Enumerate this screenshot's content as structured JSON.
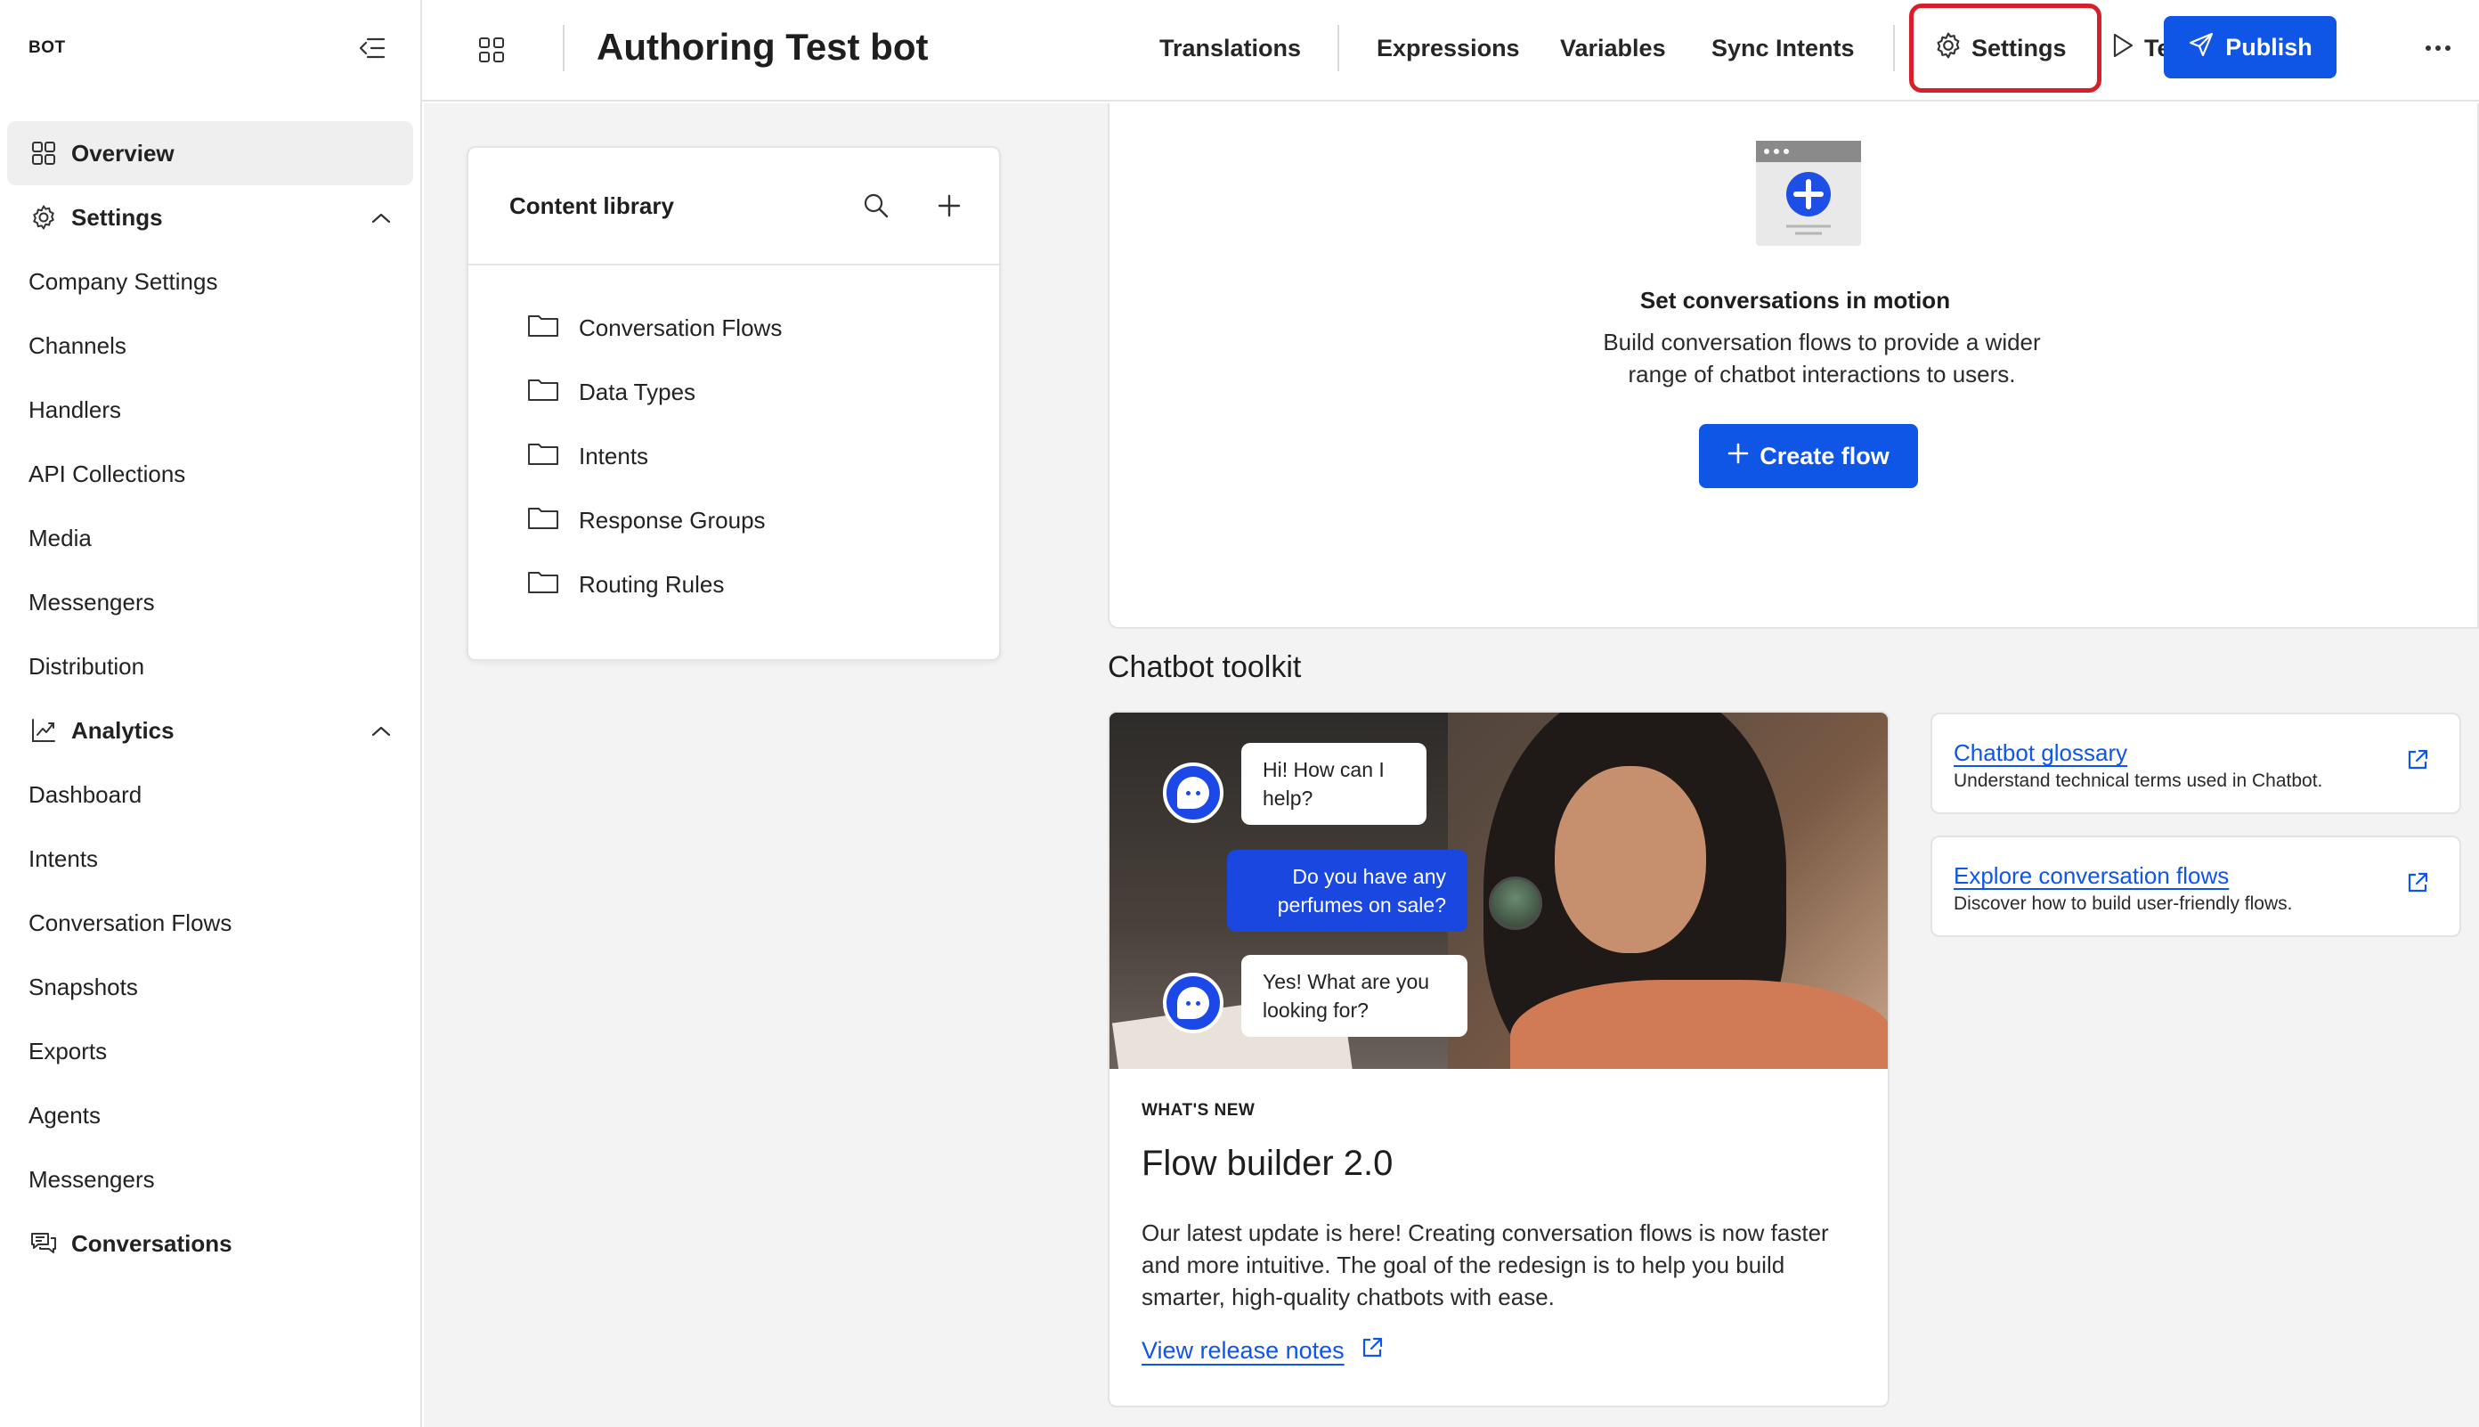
{
  "sidebar": {
    "brand": "BOT",
    "items": [
      {
        "label": "Overview",
        "type": "section",
        "icon": "grid-icon",
        "active": true
      },
      {
        "label": "Settings",
        "type": "section",
        "icon": "gear-icon",
        "expanded": true
      },
      {
        "label": "Company Settings",
        "type": "item"
      },
      {
        "label": "Channels",
        "type": "item"
      },
      {
        "label": "Handlers",
        "type": "item"
      },
      {
        "label": "API Collections",
        "type": "item"
      },
      {
        "label": "Media",
        "type": "item"
      },
      {
        "label": "Messengers",
        "type": "item"
      },
      {
        "label": "Distribution",
        "type": "item"
      },
      {
        "label": "Analytics",
        "type": "section",
        "icon": "analytics-icon",
        "expanded": true
      },
      {
        "label": "Dashboard",
        "type": "item"
      },
      {
        "label": "Intents",
        "type": "item"
      },
      {
        "label": "Conversation Flows",
        "type": "item"
      },
      {
        "label": "Snapshots",
        "type": "item"
      },
      {
        "label": "Exports",
        "type": "item"
      },
      {
        "label": "Agents",
        "type": "item"
      },
      {
        "label": "Messengers",
        "type": "item"
      },
      {
        "label": "Conversations",
        "type": "section",
        "icon": "chat-icon"
      }
    ]
  },
  "topbar": {
    "title": "Authoring Test bot",
    "nav": [
      "Translations",
      "Expressions",
      "Variables",
      "Sync Intents"
    ],
    "settings": "Settings",
    "test": "Test",
    "publish": "Publish"
  },
  "library": {
    "title": "Content library",
    "folders": [
      "Conversation Flows",
      "Data Types",
      "Intents",
      "Response Groups",
      "Routing Rules"
    ]
  },
  "flow_panel": {
    "heading": "Set conversations in motion",
    "body": "Build conversation flows to provide a wider range of chatbot interactions to users.",
    "button": "Create flow"
  },
  "toolkit": {
    "heading": "Chatbot toolkit",
    "chat": {
      "bot1": "Hi! How can I help?",
      "user": "Do you have any perfumes on sale?",
      "bot2": "Yes! What are you looking for?"
    },
    "news": {
      "kicker": "WHAT'S NEW",
      "title": "Flow builder 2.0",
      "body": "Our latest update is here! Creating conversation flows is now faster and more intuitive. The goal of the redesign is to help you build smarter, high-quality chatbots with ease.",
      "link": "View release notes"
    },
    "resources": [
      {
        "title": "Chatbot glossary",
        "desc": "Understand technical terms used in Chatbot."
      },
      {
        "title": "Explore conversation flows",
        "desc": "Discover how to build user-friendly flows."
      }
    ]
  },
  "colors": {
    "accent": "#0f55e6",
    "highlight": "#d61f2a"
  }
}
